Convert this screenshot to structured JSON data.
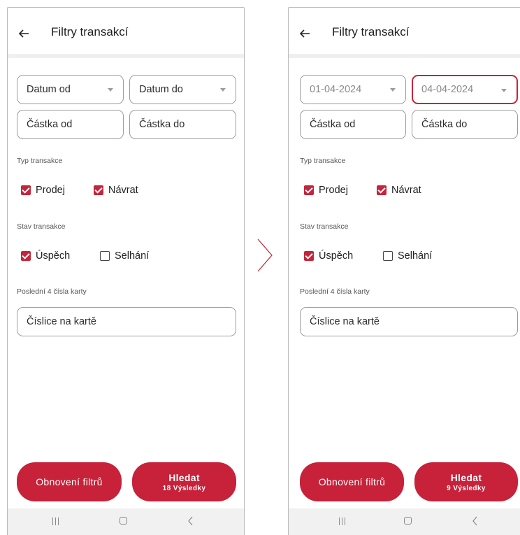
{
  "screens": [
    {
      "header": {
        "title": "Filtry transakcí"
      },
      "date_from": {
        "value": "Datum od",
        "filled": false
      },
      "date_to": {
        "value": "Datum do",
        "filled": false
      },
      "amount_from": {
        "placeholder": "Částka od"
      },
      "amount_to": {
        "placeholder": "Částka do"
      },
      "transaction_type": {
        "label": "Typ transakce",
        "options": [
          {
            "label": "Prodej",
            "checked": true
          },
          {
            "label": "Návrat",
            "checked": true
          }
        ]
      },
      "transaction_status": {
        "label": "Stav transakce",
        "options": [
          {
            "label": "Úspěch",
            "checked": true
          },
          {
            "label": "Selhání",
            "checked": false
          }
        ]
      },
      "card_digits": {
        "label": "Poslední 4 čísla karty",
        "placeholder": "Číslice na kartě"
      },
      "reset_button": {
        "label": "Obnovení filtrů"
      },
      "search_button": {
        "label": "Hledat",
        "results": "18 Výsledky"
      }
    },
    {
      "header": {
        "title": "Filtry transakcí"
      },
      "date_from": {
        "value": "01-04-2024",
        "filled": true
      },
      "date_to": {
        "value": "04-04-2024",
        "filled": true,
        "active": true
      },
      "amount_from": {
        "placeholder": "Částka od"
      },
      "amount_to": {
        "placeholder": "Částka do"
      },
      "transaction_type": {
        "label": "Typ transakce",
        "options": [
          {
            "label": "Prodej",
            "checked": true
          },
          {
            "label": "Návrat",
            "checked": true
          }
        ]
      },
      "transaction_status": {
        "label": "Stav transakce",
        "options": [
          {
            "label": "Úspěch",
            "checked": true
          },
          {
            "label": "Selhání",
            "checked": false
          }
        ]
      },
      "card_digits": {
        "label": "Poslední 4 čísla karty",
        "placeholder": "Číslice na kartě"
      },
      "reset_button": {
        "label": "Obnovení filtrů"
      },
      "search_button": {
        "label": "Hledat",
        "results": "9 Výsledky"
      }
    }
  ],
  "colors": {
    "accent": "#c8213a",
    "active_border": "#c4253a",
    "divider": "#efefef",
    "navbar": "#f1f1f1"
  },
  "icons": [
    "arrow-left-icon",
    "chevron-down-icon",
    "checkbox-checked-icon",
    "checkbox-empty-icon",
    "chevron-right-icon",
    "nav-recent-icon",
    "nav-home-icon",
    "nav-back-icon"
  ]
}
